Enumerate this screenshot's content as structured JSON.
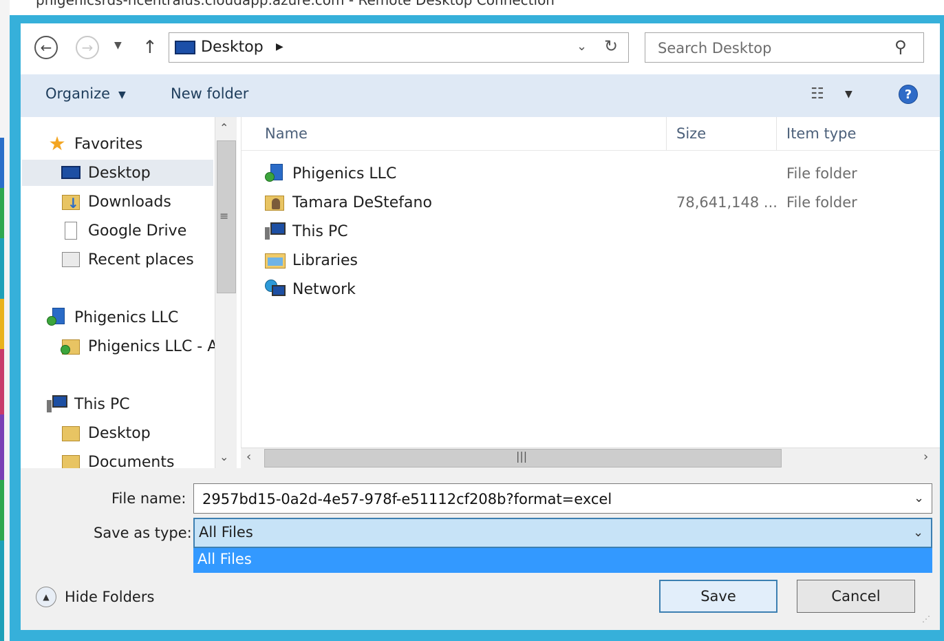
{
  "window": {
    "title": "phigenicsrds-ncentralus.cloudapp.azure.com - Remote Desktop Connection"
  },
  "address": {
    "location": "Desktop"
  },
  "search": {
    "placeholder": "Search Desktop"
  },
  "toolbar": {
    "organize_label": "Organize",
    "new_folder_label": "New folder"
  },
  "nav": {
    "items": [
      {
        "label": "Favorites",
        "icon": "star-icon"
      },
      {
        "label": "Desktop",
        "icon": "desktop-icon",
        "selected": true
      },
      {
        "label": "Downloads",
        "icon": "downloads-folder-icon"
      },
      {
        "label": "Google Drive",
        "icon": "document-icon"
      },
      {
        "label": "Recent places",
        "icon": "recent-places-icon"
      },
      {
        "label": "Phigenics LLC",
        "icon": "organization-icon"
      },
      {
        "label": "Phigenics LLC - A",
        "icon": "synced-folder-icon"
      },
      {
        "label": "This PC",
        "icon": "computer-icon"
      },
      {
        "label": "Desktop",
        "icon": "desktop-folder-icon"
      },
      {
        "label": "Documents",
        "icon": "documents-folder-icon"
      }
    ]
  },
  "files": {
    "columns": {
      "name": "Name",
      "size": "Size",
      "type": "Item type"
    },
    "rows": [
      {
        "name": "Phigenics LLC",
        "size": "",
        "type": "File folder",
        "icon": "organization-icon"
      },
      {
        "name": "Tamara DeStefano",
        "size": "78,641,148 ...",
        "type": "File folder",
        "icon": "user-folder-icon"
      },
      {
        "name": "This PC",
        "size": "",
        "type": "",
        "icon": "computer-icon"
      },
      {
        "name": "Libraries",
        "size": "",
        "type": "",
        "icon": "libraries-icon"
      },
      {
        "name": "Network",
        "size": "",
        "type": "",
        "icon": "network-icon"
      }
    ]
  },
  "form": {
    "file_name_label": "File name:",
    "file_name_value": "2957bd15-0a2d-4e57-978f-e51112cf208b?format=excel",
    "save_type_label": "Save as type:",
    "save_type_value": "All Files",
    "save_type_options": [
      "All Files"
    ]
  },
  "footer": {
    "hide_folders_label": "Hide Folders",
    "save_label": "Save",
    "cancel_label": "Cancel"
  },
  "colors": {
    "frame": "#36b0da",
    "toolbar": "#dfe9f5",
    "selection": "#3399ff",
    "combo_focus": "#c7e3f7"
  }
}
